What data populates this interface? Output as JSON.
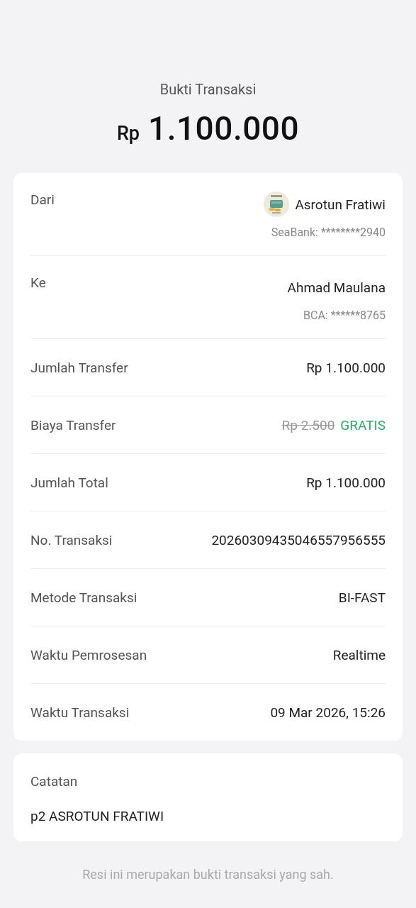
{
  "header": {
    "title": "Bukti Transaksi",
    "currency": "Rp",
    "amount": "1.100.000"
  },
  "details": [
    {
      "kind": "party",
      "label": "Dari",
      "name": "Asrotun Fratiwi",
      "account": "SeaBank: ********2940",
      "avatar": true
    },
    {
      "kind": "party",
      "label": "Ke",
      "name": "Ahmad Maulana",
      "account": "BCA: ******8765",
      "avatar": false
    },
    {
      "kind": "value",
      "label": "Jumlah Transfer",
      "value": "Rp 1.100.000"
    },
    {
      "kind": "fee",
      "label": "Biaya Transfer",
      "original": "Rp 2.500",
      "value": "GRATIS"
    },
    {
      "kind": "value",
      "label": "Jumlah Total",
      "value": "Rp 1.100.000"
    },
    {
      "kind": "value",
      "label": "No. Transaksi",
      "value": "20260309435046557956555"
    },
    {
      "kind": "value",
      "label": "Metode Transaksi",
      "value": "BI-FAST"
    },
    {
      "kind": "value",
      "label": "Waktu Pemrosesan",
      "value": "Realtime"
    },
    {
      "kind": "value",
      "label": "Waktu Transaksi",
      "value": "09 Mar 2026, 15:26"
    }
  ],
  "note": {
    "label": "Catatan",
    "text": "p2 ASROTUN FRATIWI"
  },
  "footer": "Resi ini merupakan bukti transaksi yang sah."
}
